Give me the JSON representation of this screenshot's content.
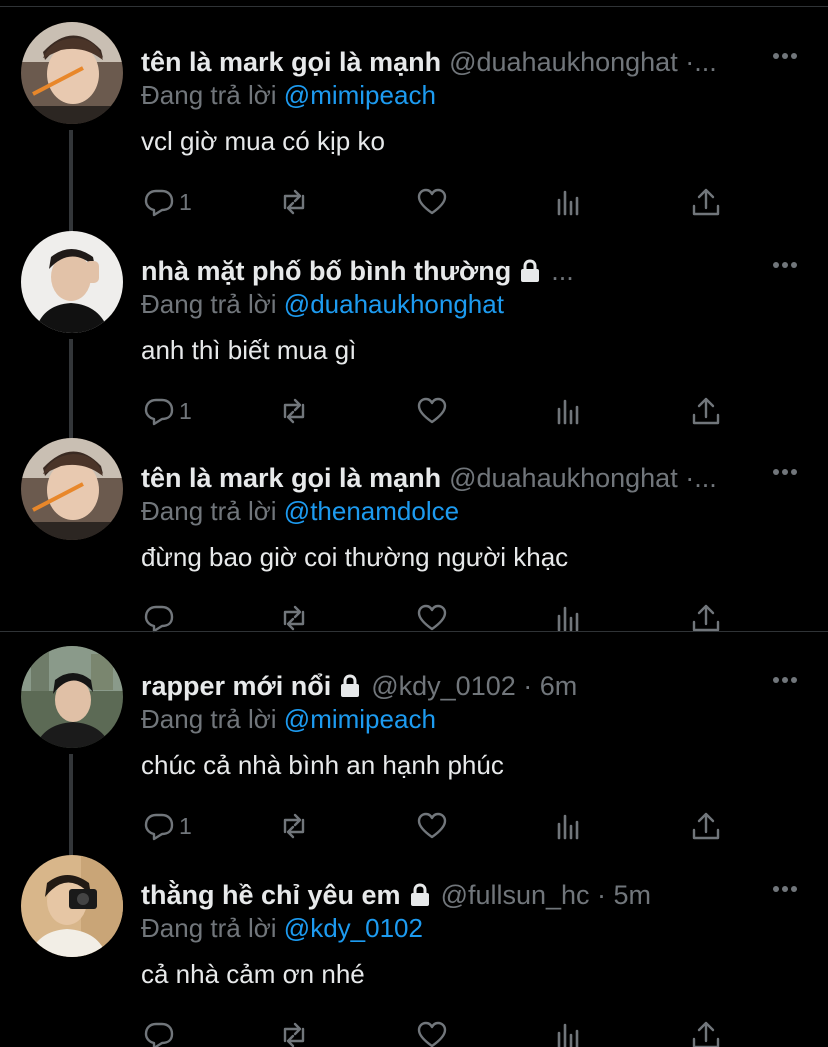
{
  "tweets": [
    {
      "name": "tên là mark gọi là mạnh",
      "handle_meta": "@duahaukhonghat ·...",
      "reply_prefix": "Đang trả lời",
      "reply_to": "@mimipeach",
      "text": "vcl giờ mua có kịp ko",
      "reply_count": "1",
      "locked": false
    },
    {
      "name": "nhà mặt phố bố bình thường",
      "handle_meta": "...",
      "reply_prefix": "Đang trả lời",
      "reply_to": "@duahaukhonghat",
      "text": "anh thì biết mua gì",
      "reply_count": "1",
      "locked": true
    },
    {
      "name": "tên là mark gọi là mạnh",
      "handle_meta": "@duahaukhonghat ·...",
      "reply_prefix": "Đang trả lời",
      "reply_to": "@thenamdolce",
      "text": "đừng bao giờ coi thường người khạc",
      "reply_count": "",
      "locked": false
    },
    {
      "name": "rapper mới nổi",
      "handle_meta": "@kdy_0102 · 6m",
      "reply_prefix": "Đang trả lời",
      "reply_to": "@mimipeach",
      "text": "chúc cả nhà bình an hạnh phúc",
      "reply_count": "1",
      "locked": true
    },
    {
      "name": "thằng hề chỉ yêu em",
      "handle_meta": "@fullsun_hc · 5m",
      "reply_prefix": "Đang trả lời",
      "reply_to": "@kdy_0102",
      "text": "cả nhà cảm ơn nhé",
      "reply_count": "",
      "locked": true
    }
  ],
  "icons": {
    "reply": "reply-icon",
    "retweet": "retweet-icon",
    "like": "like-icon",
    "analytics": "analytics-icon",
    "share": "share-icon",
    "more": "more-icon",
    "lock": "lock-icon"
  },
  "colors": {
    "background": "#000000",
    "text": "#e7e9ea",
    "muted": "#71767b",
    "accent": "#1d9bf0",
    "divider": "#2f3336"
  }
}
